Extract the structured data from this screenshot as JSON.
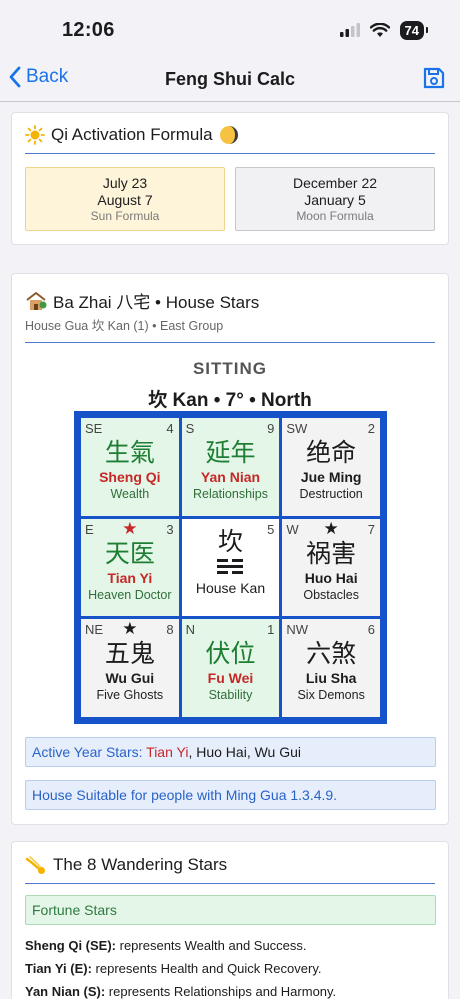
{
  "status": {
    "time": "12:06",
    "battery": "74"
  },
  "nav": {
    "back_label": "Back",
    "title": "Feng Shui Calc"
  },
  "qi": {
    "title": "Qi Activation Formula",
    "sun": {
      "line1": "July 23",
      "line2": "August 7",
      "label": "Sun Formula"
    },
    "moon": {
      "line1": "December 22",
      "line2": "January 5",
      "label": "Moon Formula"
    }
  },
  "bazhai": {
    "title": "Ba Zhai 八宅 • House Stars",
    "subtitle": "House Gua 坎 Kan (1) • East Group",
    "sitting_label": "SITTING",
    "sitting_value": "坎 Kan • 7° • North",
    "cells": [
      {
        "dir": "SE",
        "num": "4",
        "han": "生氣",
        "pinyin": "Sheng Qi",
        "meaning": "Wealth",
        "good": true,
        "star": ""
      },
      {
        "dir": "S",
        "num": "9",
        "han": "延年",
        "pinyin": "Yan Nian",
        "meaning": "Relationships",
        "good": true,
        "star": ""
      },
      {
        "dir": "SW",
        "num": "2",
        "han": "绝命",
        "pinyin": "Jue Ming",
        "meaning": "Destruction",
        "good": false,
        "star": ""
      },
      {
        "dir": "E",
        "num": "3",
        "han": "天医",
        "pinyin": "Tian Yi",
        "meaning": "Heaven Doctor",
        "good": true,
        "star": "red"
      },
      {
        "dir": "",
        "num": "5",
        "han": "坎",
        "pinyin": "",
        "meaning": "House Kan",
        "good": false,
        "star": "",
        "center": true
      },
      {
        "dir": "W",
        "num": "7",
        "han": "祸害",
        "pinyin": "Huo Hai",
        "meaning": "Obstacles",
        "good": false,
        "star": "black"
      },
      {
        "dir": "NE",
        "num": "8",
        "han": "五鬼",
        "pinyin": "Wu Gui",
        "meaning": "Five Ghosts",
        "good": false,
        "star": "black"
      },
      {
        "dir": "N",
        "num": "1",
        "han": "伏位",
        "pinyin": "Fu Wei",
        "meaning": "Stability",
        "good": true,
        "star": ""
      },
      {
        "dir": "NW",
        "num": "6",
        "han": "六煞",
        "pinyin": "Liu Sha",
        "meaning": "Six Demons",
        "good": false,
        "star": ""
      }
    ],
    "active_year": {
      "label": "Active Year Stars:",
      "star1": "Tian Yi",
      "sep1": ",",
      "star2": "Huo Hai",
      "sep2": ",",
      "star3": "Wu Gui"
    },
    "suitable": "House Suitable for people with Ming Gua 1.3.4.9."
  },
  "wandering": {
    "title": "The 8 Wandering Stars",
    "fortune_label": "Fortune Stars",
    "items": [
      {
        "name": "Sheng Qi (SE):",
        "text": " represents Wealth and Success."
      },
      {
        "name": "Tian Yi (E):",
        "text": " represents Health and Quick Recovery."
      },
      {
        "name": "Yan Nian (S):",
        "text": " represents Relationships and Harmony."
      }
    ]
  },
  "colors": {
    "accent": "#1a73e8",
    "grid_border": "#1652c8",
    "good_green": "#1e7e34",
    "good_red": "#c62828"
  },
  "icons": {
    "sun": "sun-icon",
    "moon": "moon-icon",
    "house": "house-icon",
    "comet": "comet-icon",
    "save": "save-icon"
  }
}
